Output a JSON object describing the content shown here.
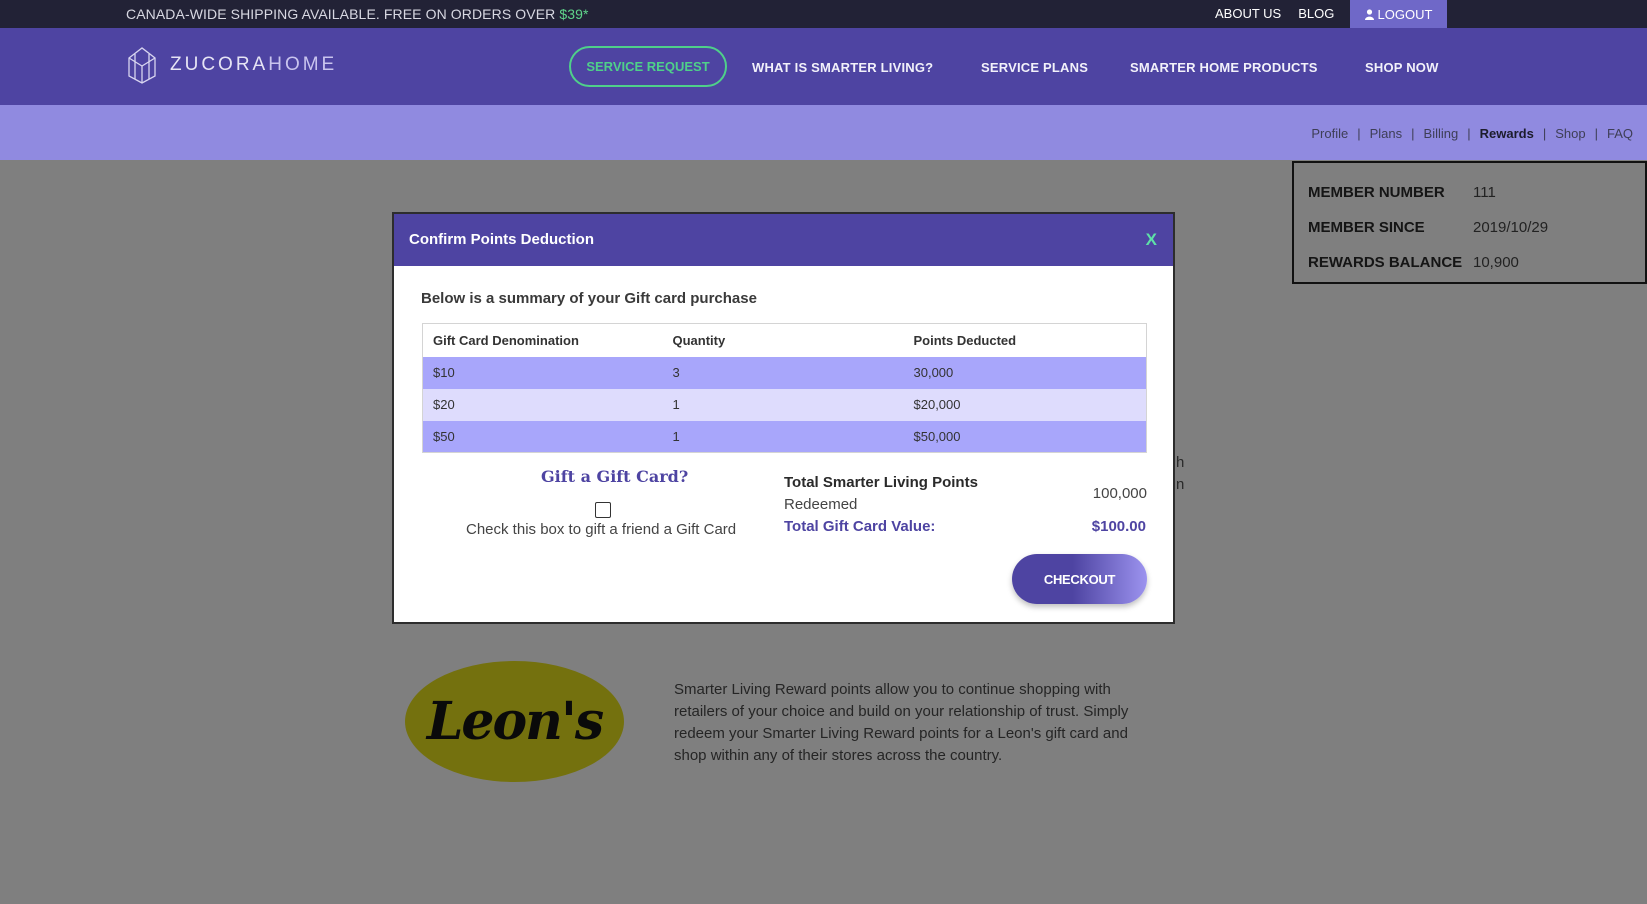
{
  "topbar": {
    "shipping_prefix": "CANADA-WIDE SHIPPING AVAILABLE. FREE ON ORDERS OVER ",
    "shipping_amount": "$39*",
    "about": "ABOUT US",
    "blog": "BLOG",
    "logout": "LOGOUT"
  },
  "nav": {
    "brand_main": "ZUCORA",
    "brand_suffix": "HOME",
    "service_request": "SERVICE REQUEST",
    "links": [
      "WHAT IS SMARTER LIVING?",
      "SERVICE PLANS",
      "SMARTER HOME PRODUCTS",
      "SHOP NOW"
    ]
  },
  "subnav": {
    "links": [
      "Profile",
      "Plans",
      "Billing",
      "Rewards",
      "Shop",
      "FAQ"
    ],
    "active": "Rewards"
  },
  "member": {
    "rows": [
      {
        "label": "MEMBER NUMBER",
        "value": "111"
      },
      {
        "label": "MEMBER SINCE",
        "value": "2019/10/29"
      },
      {
        "label": "REWARDS BALANCE",
        "value": "10,900"
      }
    ]
  },
  "background": {
    "partial_letters": [
      "h",
      "n"
    ],
    "partner_logo": "Leon's",
    "paragraph": "Smarter Living Reward points allow you to continue shopping with retailers of your choice and build on your relationship of trust. Simply redeem your Smarter Living Reward points for a Leon's gift card and shop within any of their stores across the country."
  },
  "modal": {
    "title": "Confirm Points Deduction",
    "close": "X",
    "summary": "Below is a summary of your Gift card purchase",
    "table": {
      "headers": [
        "Gift Card Denomination",
        "Quantity",
        "Points Deducted"
      ],
      "rows": [
        [
          "$10",
          "3",
          "30,000"
        ],
        [
          "$20",
          "1",
          "$20,000"
        ],
        [
          "$50",
          "1",
          "$50,000"
        ]
      ]
    },
    "gift_question": "Gift a Gift Card?",
    "gift_checkbox_label": "Check this box to gift a friend a Gift Card",
    "gift_checked": false,
    "total_points_label": "Total Smarter Living Points",
    "total_points_label2": "Redeemed",
    "total_points_value": "100,000",
    "total_value_label": "Total Gift Card Value:",
    "total_value": "$100.00",
    "checkout": "CHECKOUT"
  },
  "colors": {
    "brand_purple": "#4e44a2",
    "accent_green": "#4fd08a",
    "row_dark": "#a8a6fb",
    "row_light": "#dedcfd"
  }
}
